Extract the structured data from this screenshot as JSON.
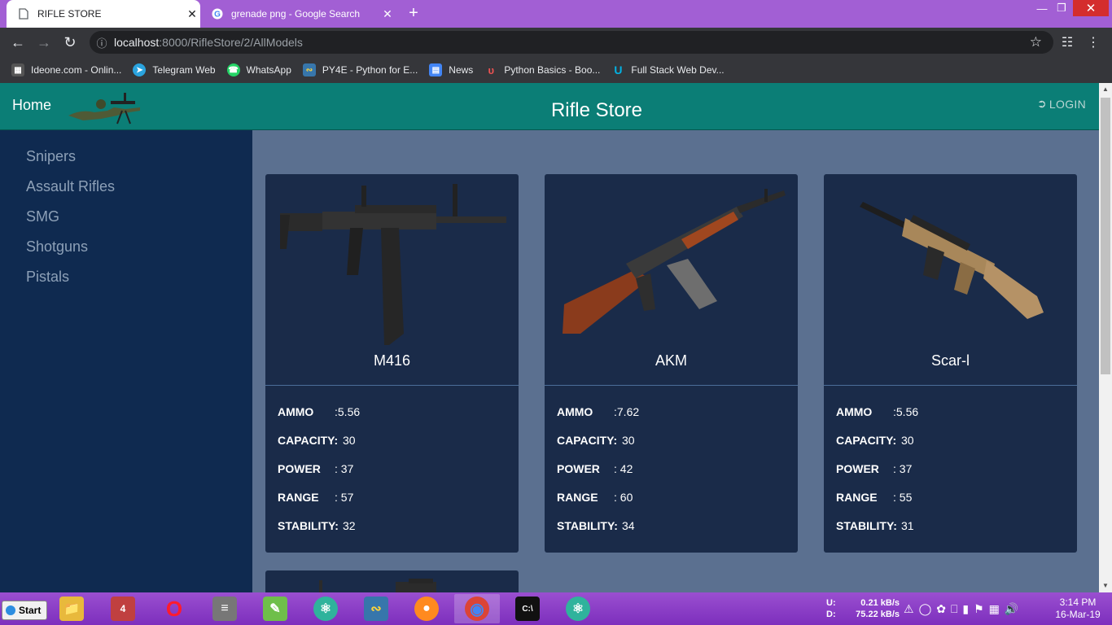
{
  "browser": {
    "tabs": [
      {
        "title": "RIFLE STORE",
        "active": true
      },
      {
        "title": "grenade png - Google Search",
        "active": false
      }
    ],
    "new_tab_label": "+",
    "close_label": "✕",
    "url_host": "localhost",
    "url_path": ":8000/RifleStore/2/AllModels",
    "bookmarks": [
      {
        "label": "Ideone.com - Onlin...",
        "icon": "ideone-icon",
        "color": "#555555"
      },
      {
        "label": "Telegram Web",
        "icon": "telegram-icon",
        "color": "#2aa3de"
      },
      {
        "label": "WhatsApp",
        "icon": "whatsapp-icon",
        "color": "#25d366"
      },
      {
        "label": "PY4E - Python for E...",
        "icon": "python-icon",
        "color": "#3776ab"
      },
      {
        "label": "News",
        "icon": "google-news-icon",
        "color": "#4285f4"
      },
      {
        "label": "Python Basics - Boo...",
        "icon": "udemy-icon",
        "color": "#ec5252"
      },
      {
        "label": "Full Stack Web Dev...",
        "icon": "udacity-icon",
        "color": "#02b3e4"
      }
    ]
  },
  "site": {
    "home_label": "Home",
    "title": "Rifle Store",
    "login_label": "LOGIN",
    "sidebar": [
      "Snipers",
      "Assault Rifles",
      "SMG",
      "Shotguns",
      "Pistals"
    ],
    "stat_labels": {
      "ammo": "AMMO",
      "capacity": "CAPACITY:",
      "power": "POWER",
      "range": "RANGE",
      "stability": "STABILITY:"
    },
    "cards": [
      {
        "name": "M416",
        "ammo": ":5.56",
        "capacity": "30",
        "power": ": 37",
        "range": ": 57",
        "stability": "32"
      },
      {
        "name": "AKM",
        "ammo": ":7.62",
        "capacity": "30",
        "power": ": 42",
        "range": ": 60",
        "stability": "34"
      },
      {
        "name": "Scar-l",
        "ammo": ":5.56",
        "capacity": "30",
        "power": ": 37",
        "range": ": 55",
        "stability": "31"
      }
    ],
    "colors": {
      "navbar": "#0b7e76",
      "sidebar": "#0f2a50",
      "content": "#5b7090",
      "card": "#1a2b49"
    }
  },
  "taskbar": {
    "start_label": "Start",
    "net_up_label": "U:",
    "net_up_value": "0.21 kB/s",
    "net_down_label": "D:",
    "net_down_value": "75.22 kB/s",
    "time": "3:14 PM",
    "date": "16-Mar-19",
    "badge": "4"
  }
}
